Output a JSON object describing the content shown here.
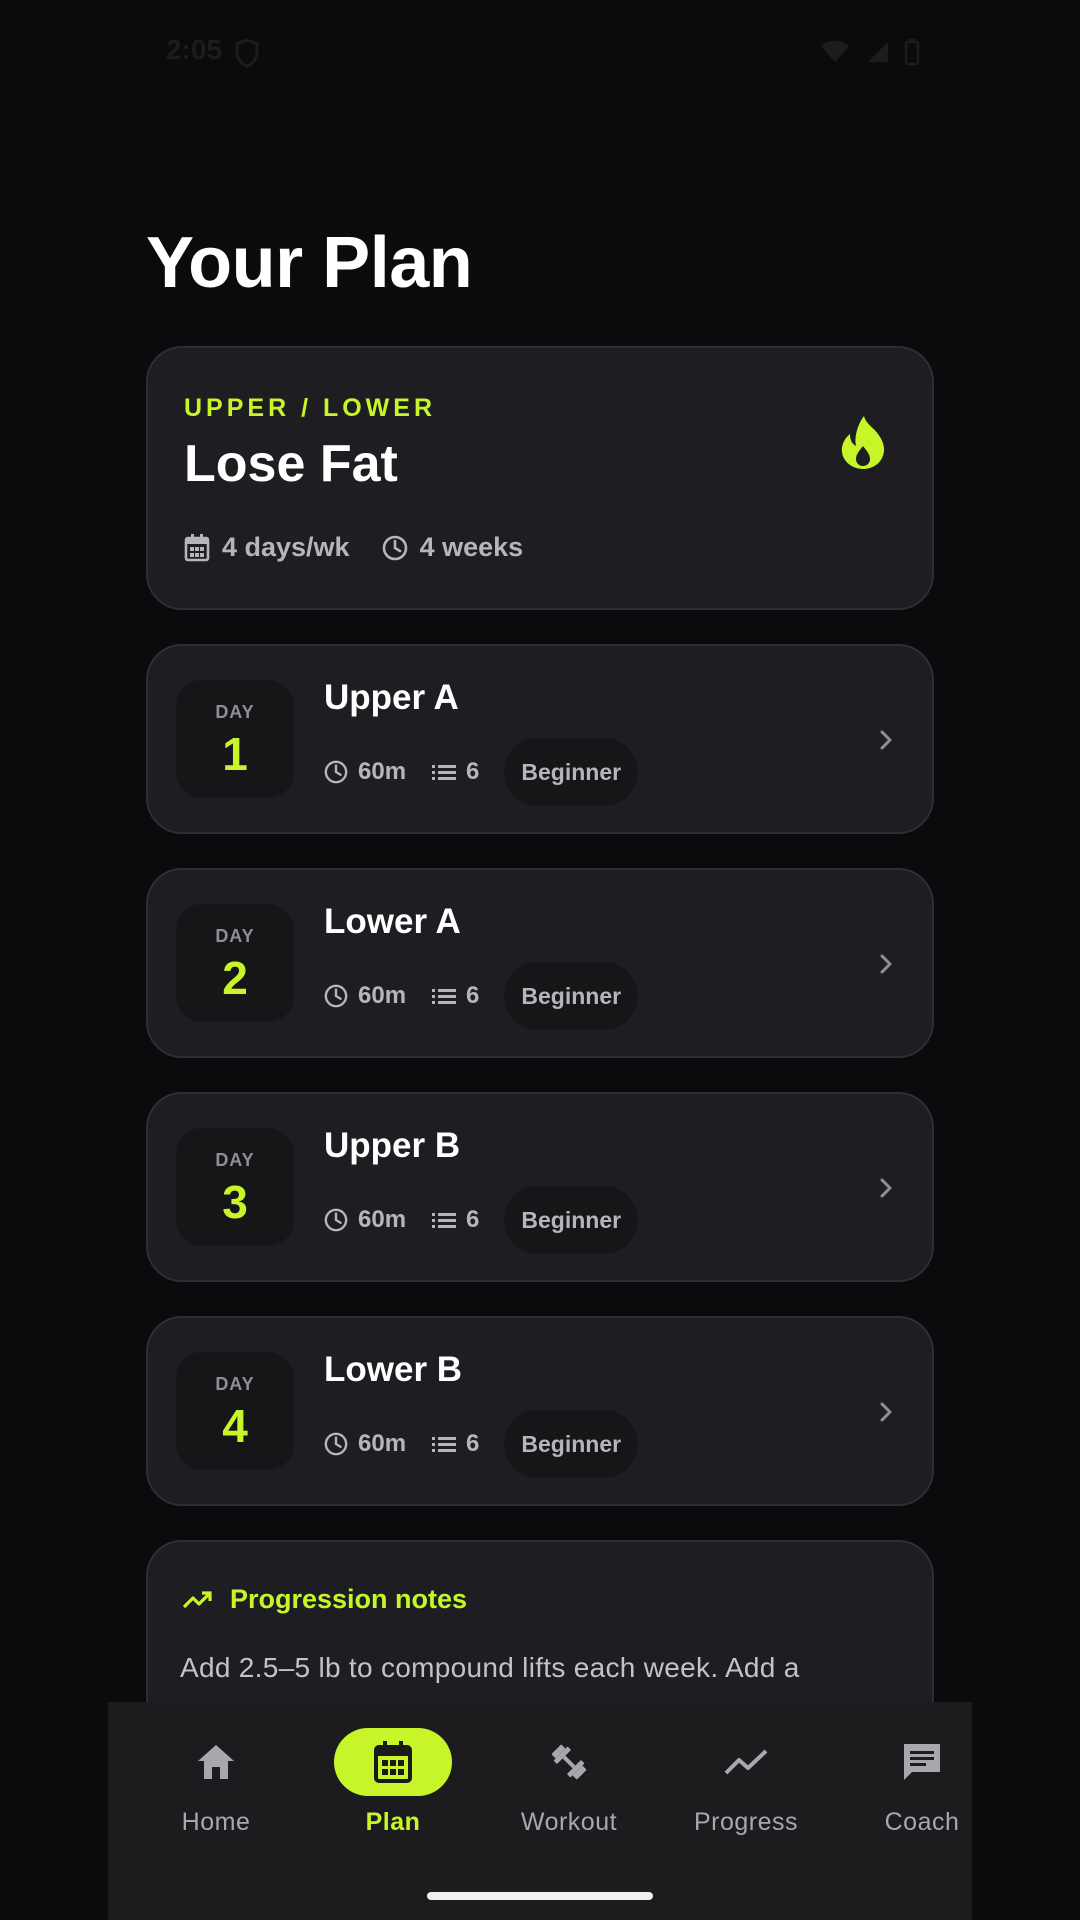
{
  "status_bar": {
    "time": "2:05"
  },
  "page": {
    "title": "Your Plan"
  },
  "plan": {
    "kicker": "UPPER / LOWER",
    "name": "Lose Fat",
    "frequency": "4 days/wk",
    "duration": "4 weeks",
    "icon": "flame-icon"
  },
  "days": [
    {
      "label": "DAY",
      "number": "1",
      "title": "Upper A",
      "time": "60m",
      "exercises": "6",
      "level": "Beginner"
    },
    {
      "label": "DAY",
      "number": "2",
      "title": "Lower A",
      "time": "60m",
      "exercises": "6",
      "level": "Beginner"
    },
    {
      "label": "DAY",
      "number": "3",
      "title": "Upper B",
      "time": "60m",
      "exercises": "6",
      "level": "Beginner"
    },
    {
      "label": "DAY",
      "number": "4",
      "title": "Lower B",
      "time": "60m",
      "exercises": "6",
      "level": "Beginner"
    }
  ],
  "notes": {
    "title": "Progression notes",
    "body": "Add 2.5–5 lb to compound lifts each week. Add a"
  },
  "nav": {
    "items": [
      {
        "label": "Home",
        "icon": "home-icon"
      },
      {
        "label": "Plan",
        "icon": "calendar-icon",
        "active": true
      },
      {
        "label": "Workout",
        "icon": "dumbbell-icon"
      },
      {
        "label": "Progress",
        "icon": "trending-icon"
      },
      {
        "label": "Coach",
        "icon": "chat-icon"
      }
    ]
  },
  "colors": {
    "accent": "#c8f52a",
    "background": "#0b0b0d",
    "card": "#1e1e22"
  }
}
